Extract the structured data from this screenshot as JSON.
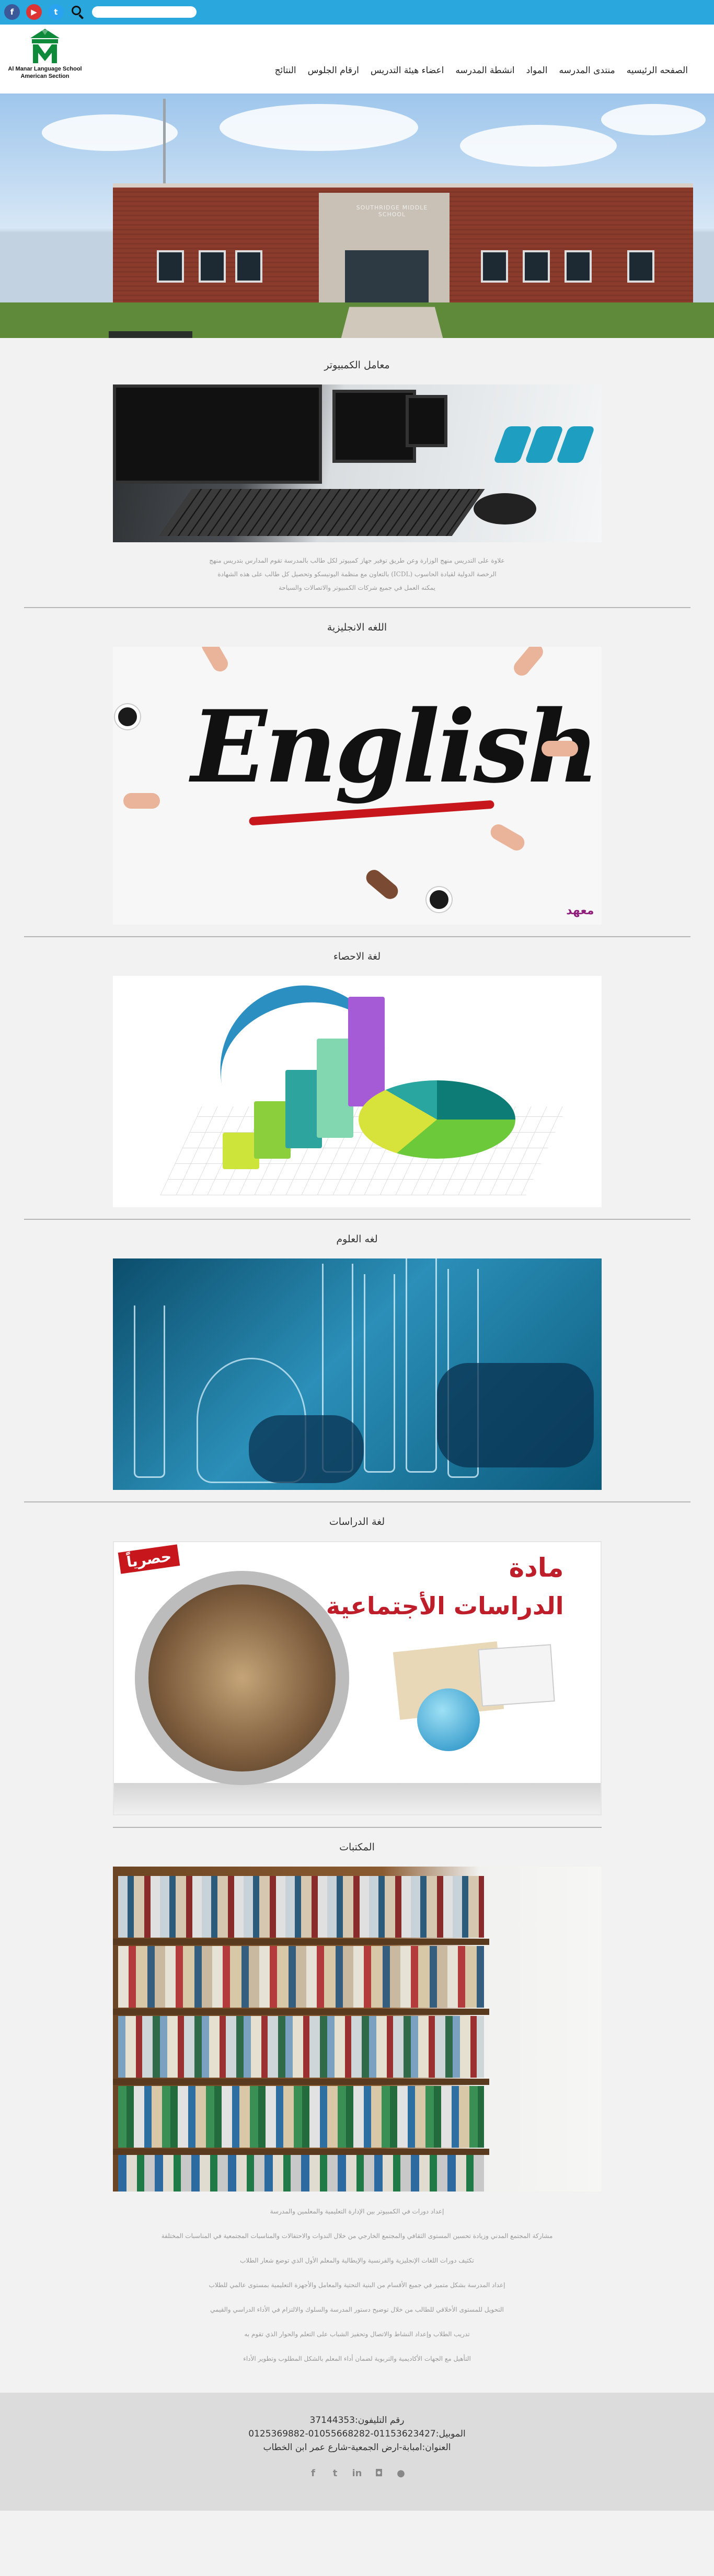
{
  "topbar": {
    "social": [
      {
        "name": "facebook",
        "glyph": "f"
      },
      {
        "name": "youtube",
        "glyph": "▶"
      },
      {
        "name": "twitter",
        "glyph": "t"
      }
    ],
    "search_placeholder": ""
  },
  "logo": {
    "line1": "Al Manar Language School",
    "line2": "American Section"
  },
  "nav": {
    "items": [
      "الصفحه الرئيسيه",
      "منتدى المدرسه",
      "المواد",
      "انشطة المدرسه",
      "اعضاء هيئة التدريس",
      "ارقام الجلوس",
      "النتائج"
    ]
  },
  "hero": {
    "building_sign": "SOUTHRIDGE MIDDLE SCHOOL"
  },
  "sections": {
    "computer": {
      "title": "معامل الكمبيوتر",
      "desc_lines": [
        "علاوة على التدريس منهج الوزارة وعن طريق توفير جهاز كمبيوتر لكل طالب بالمدرسة تقوم المدارس بتدريس منهج",
        "الرخصة الدولية لقيادة الحاسوب (ICDL) بالتعاون مع منظمة اليونيسكو وتحصيل كل طالب على هذه الشهادة",
        "يمكنه العمل في جميع شركات الكمبيوتر والاتصالات والسياحة"
      ]
    },
    "english": {
      "title": "اللغه الانجليزية",
      "image_word": "English",
      "brand": "معهد"
    },
    "statistics": {
      "title": "لغة الاحصاء"
    },
    "science": {
      "title": "لغه العلوم"
    },
    "social": {
      "title": "لغة الدراسات",
      "image_title1": "مادة",
      "image_title2": "الدراسات الأجتماعية",
      "image_badge": "حصرياً"
    },
    "library": {
      "title": "المكتبات",
      "list": [
        "إعداد دورات في الكمبيوتر بين الإدارة التعليمية والمعلمين والمدرسة",
        "مشاركة المجتمع المدني وزيادة تحسين المستوى الثقافي والمجتمع الخارجي من خلال الندوات والاحتفالات والمناسبات المجتمعية في المناسبات المختلفة",
        "تكثيف دورات اللغات الإنجليزية والفرنسية والإيطالية والمعلم الأول الذي توضع شعار الطلاب",
        "إعداد المدرسة بشكل متميز في جميع الأقسام من البنية التحتية والمعامل والأجهزة التعليمية بمستوى عالمي للطلاب",
        "التحويل للمستوى الأخلاقي للطالب من خلال توضيح دستور المدرسة والسلوك والالتزام في الأداء الدراسي والقيمي",
        "تدريب الطلاب وإعداد النشاط والاتصال وتحفيز الشباب على التعلم والحوار الذي تقوم به",
        "التأهيل مع الجهات الأكاديمية والتربوية لضمان أداء المعلم بالشكل المطلوب وتطوير الأداء"
      ]
    }
  },
  "footer": {
    "phone": "رقم التليفون:37144353",
    "mobile": "الموبيل:01153623427-01055668282-0125369882",
    "address": "العنوان:امبابة-ارض الجمعية-شارع عمر ابن الخطاب",
    "icons": [
      "facebook-icon",
      "twitter-icon",
      "linkedin-icon",
      "instagram-icon",
      "apple-icon"
    ]
  }
}
